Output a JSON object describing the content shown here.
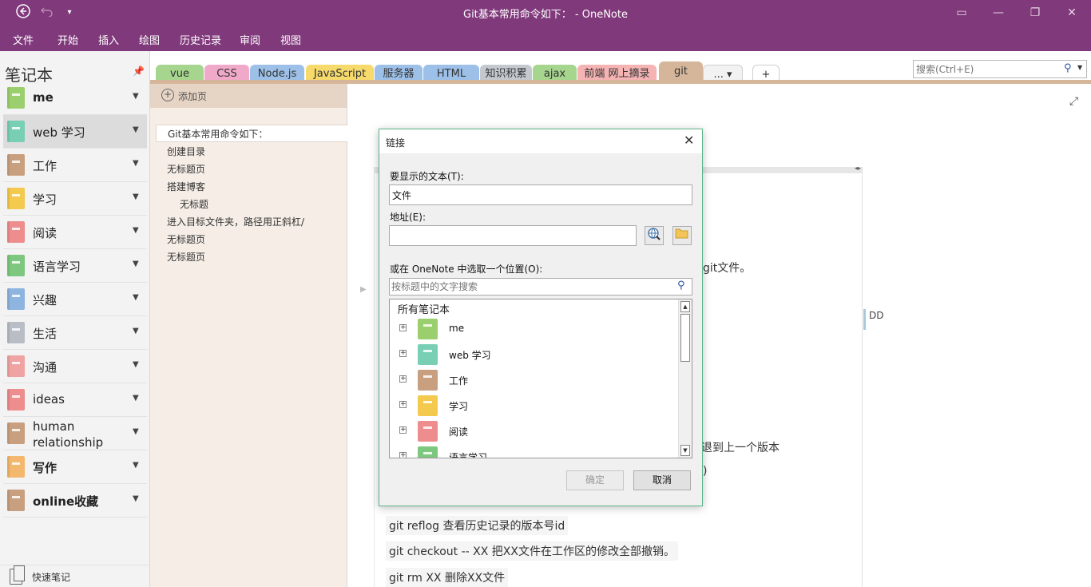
{
  "window": {
    "title": "Git基本常用命令如下：  -  OneNote",
    "back_icon": "back-arrow-icon",
    "undo_icon": "undo-icon",
    "qat_icon": "qat-dropdown-icon"
  },
  "menu": [
    "文件",
    "开始",
    "插入",
    "绘图",
    "历史记录",
    "审阅",
    "视图"
  ],
  "notebooks": {
    "header": "笔记本",
    "items": [
      {
        "label": "me",
        "color": "#9bcf6e",
        "bold": true
      },
      {
        "label": "web 学习",
        "color": "#79cfb4",
        "bold": false
      },
      {
        "label": "工作",
        "color": "#c9a07f",
        "bold": false
      },
      {
        "label": "学习",
        "color": "#f3c94e",
        "bold": false
      },
      {
        "label": "阅读",
        "color": "#ee8d8d",
        "bold": false
      },
      {
        "label": "语言学习",
        "color": "#7dc77f",
        "bold": false
      },
      {
        "label": "兴趣",
        "color": "#8eb4e0",
        "bold": false
      },
      {
        "label": "生活",
        "color": "#b9bec6",
        "bold": false
      },
      {
        "label": "沟通",
        "color": "#f0a3a3",
        "bold": false
      },
      {
        "label": "ideas",
        "color": "#ee8d8d",
        "bold": false
      },
      {
        "label": "human relationship",
        "color": "#c9a07f",
        "bold": false
      },
      {
        "label": "写作",
        "color": "#f4b76e",
        "bold": true
      },
      {
        "label": "online收藏",
        "color": "#c9a07f",
        "bold": true
      }
    ],
    "quick_notes": "快速笔记"
  },
  "sections": {
    "tabs": [
      {
        "label": "vue",
        "color": "#a6d58e"
      },
      {
        "label": "CSS",
        "color": "#f1a9c9"
      },
      {
        "label": "Node.js",
        "color": "#9cc0e8"
      },
      {
        "label": "JavaScript",
        "color": "#f6da6b"
      },
      {
        "label": "服务器",
        "color": "#9cc0e8"
      },
      {
        "label": "HTML",
        "color": "#9cc0e8"
      },
      {
        "label": "知识积累",
        "color": "#c4c8cf"
      },
      {
        "label": "ajax",
        "color": "#a6d58e"
      },
      {
        "label": "前端 网上摘录",
        "color": "#f5b3b3"
      },
      {
        "label": "git",
        "color": "#d5b69b"
      }
    ],
    "more_label": "...",
    "add_label": "+"
  },
  "search": {
    "placeholder": "搜索(Ctrl+E)"
  },
  "pages": {
    "add_label": "添加页",
    "items": [
      {
        "label": "Git基本常用命令如下：",
        "type": "active"
      },
      {
        "label": "创建目录",
        "type": "normal"
      },
      {
        "label": "无标题页",
        "type": "normal"
      },
      {
        "label": "搭建博客",
        "type": "normal"
      },
      {
        "label": "无标题",
        "type": "sub"
      },
      {
        "label": "进入目标文件夹，路径用正斜杠/",
        "type": "normal"
      },
      {
        "label": "无标题页",
        "type": "normal"
      },
      {
        "label": "无标题页",
        "type": "normal"
      }
    ]
  },
  "note": {
    "frag_git_file": "git文件。",
    "frag_revert": "退到上一个版本",
    "frag_paren": ")",
    "line_reflog": "git reflog       查看历史记录的版本号id",
    "line_checkout": "git checkout -- XX  把XX文件在工作区的修改全部撤销。",
    "line_rm": "git rm XX          删除XX文件",
    "dd_label": "DD"
  },
  "dialog": {
    "title": "链接",
    "display_text_label": "要显示的文本(T):",
    "display_text_value": "文件",
    "address_label": "地址(E):",
    "address_value": "",
    "pick_label": "或在 OneNote 中选取一个位置(O):",
    "pick_search_placeholder": "按标题中的文字搜索",
    "tree_root": "所有笔记本",
    "tree_items": [
      {
        "label": "me",
        "color": "#9bcf6e"
      },
      {
        "label": "web 学习",
        "color": "#79cfb4"
      },
      {
        "label": "工作",
        "color": "#c9a07f"
      },
      {
        "label": "学习",
        "color": "#f3c94e"
      },
      {
        "label": "阅读",
        "color": "#ee8d8d"
      },
      {
        "label": "语言学习",
        "color": "#7dc77f"
      }
    ],
    "ok_label": "确定",
    "cancel_label": "取消"
  }
}
